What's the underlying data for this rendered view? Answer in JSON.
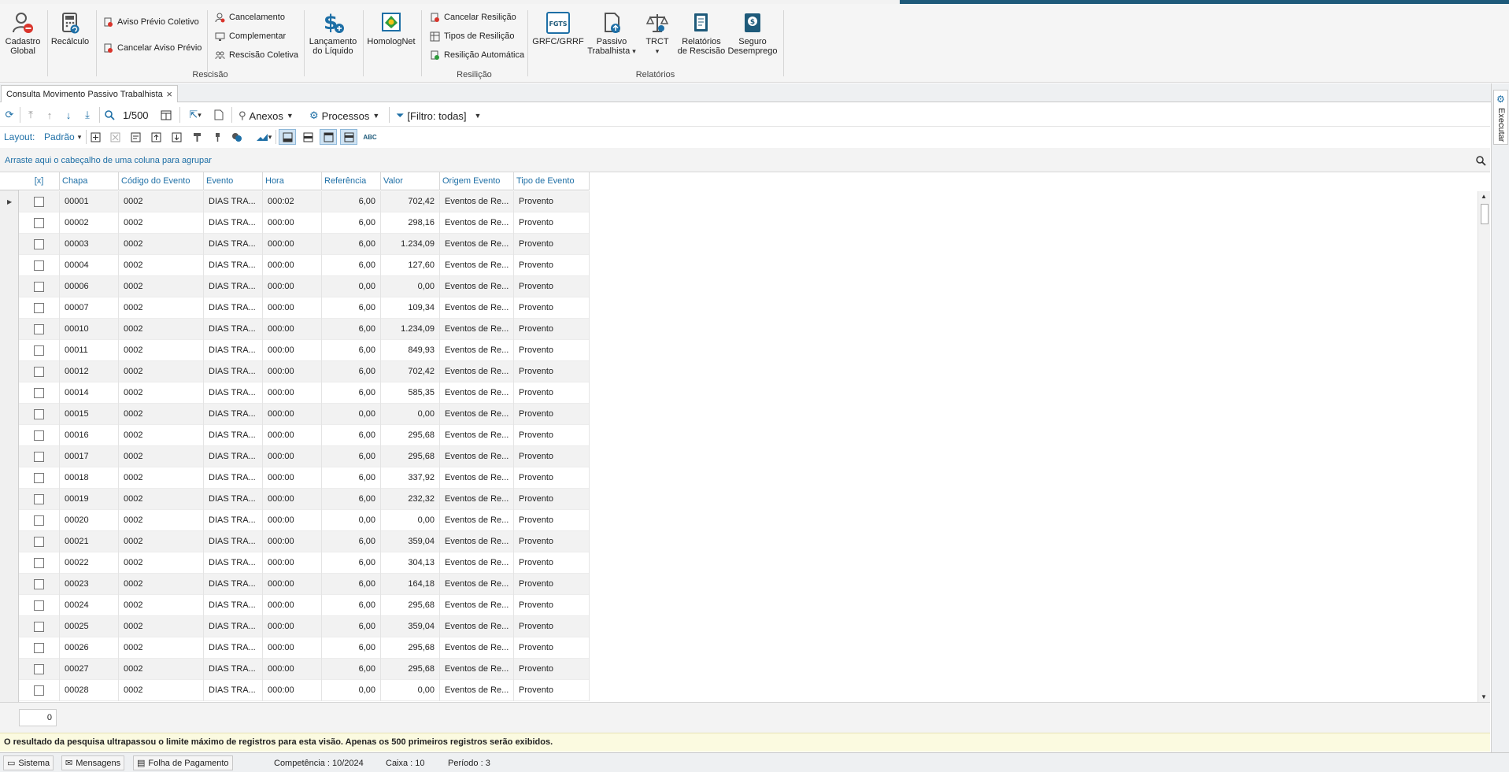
{
  "ribbon": {
    "cadastro_global": [
      "Cadastro",
      "Global"
    ],
    "recalculo": "Recálculo",
    "aviso_previo_coletivo": "Aviso Prévio Coletivo",
    "cancelar_aviso_previo": "Cancelar Aviso Prévio",
    "cancelamento": "Cancelamento",
    "complementar": "Complementar",
    "rescisao_coletiva": "Rescisão Coletiva",
    "lancamento_liquido": [
      "Lançamento",
      "do Líquido"
    ],
    "homolognet": "HomologNet",
    "cancelar_resiliacao": "Cancelar Resilição",
    "tipos_resiliacao": "Tipos de Resilição",
    "resiliacao_automatica": "Resilição Automática",
    "grfc_grrf": "GRFC/GRRF",
    "passivo_trabalhista": [
      "Passivo",
      "Trabalhista"
    ],
    "trct": "TRCT",
    "relatorios_rescisao": [
      "Relatórios",
      "de Rescisão"
    ],
    "seguro_desemprego": [
      "Seguro",
      "Desemprego"
    ],
    "fgts_icon_text": "FGTS",
    "group_rescisao": "Rescisão",
    "group_resiliacao": "Resilição",
    "group_relatorios": "Relatórios"
  },
  "tab": {
    "title": "Consulta Movimento Passivo Trabalhista"
  },
  "toolbar": {
    "record_counter": "1/500",
    "anexos": "Anexos",
    "processos": "Processos",
    "filtro": "[Filtro: todas]",
    "layout_label": "Layout:",
    "layout_value": "Padrão"
  },
  "group_hint": "Arraste aqui o cabeçalho de uma coluna para agrupar",
  "grid": {
    "columns": [
      "[x]",
      "Chapa",
      "Código do Evento",
      "Evento",
      "Hora",
      "Referência",
      "Valor",
      "Origem Evento",
      "Tipo de Evento"
    ],
    "rows": [
      {
        "chapa": "00001",
        "codigo": "0002",
        "evento": "DIAS TRA...",
        "hora": "000:02",
        "referencia": "6,00",
        "valor": "702,42",
        "origem": "Eventos de Re...",
        "tipo": "Provento"
      },
      {
        "chapa": "00002",
        "codigo": "0002",
        "evento": "DIAS TRA...",
        "hora": "000:00",
        "referencia": "6,00",
        "valor": "298,16",
        "origem": "Eventos de Re...",
        "tipo": "Provento"
      },
      {
        "chapa": "00003",
        "codigo": "0002",
        "evento": "DIAS TRA...",
        "hora": "000:00",
        "referencia": "6,00",
        "valor": "1.234,09",
        "origem": "Eventos de Re...",
        "tipo": "Provento"
      },
      {
        "chapa": "00004",
        "codigo": "0002",
        "evento": "DIAS TRA...",
        "hora": "000:00",
        "referencia": "6,00",
        "valor": "127,60",
        "origem": "Eventos de Re...",
        "tipo": "Provento"
      },
      {
        "chapa": "00006",
        "codigo": "0002",
        "evento": "DIAS TRA...",
        "hora": "000:00",
        "referencia": "0,00",
        "valor": "0,00",
        "origem": "Eventos de Re...",
        "tipo": "Provento"
      },
      {
        "chapa": "00007",
        "codigo": "0002",
        "evento": "DIAS TRA...",
        "hora": "000:00",
        "referencia": "6,00",
        "valor": "109,34",
        "origem": "Eventos de Re...",
        "tipo": "Provento"
      },
      {
        "chapa": "00010",
        "codigo": "0002",
        "evento": "DIAS TRA...",
        "hora": "000:00",
        "referencia": "6,00",
        "valor": "1.234,09",
        "origem": "Eventos de Re...",
        "tipo": "Provento"
      },
      {
        "chapa": "00011",
        "codigo": "0002",
        "evento": "DIAS TRA...",
        "hora": "000:00",
        "referencia": "6,00",
        "valor": "849,93",
        "origem": "Eventos de Re...",
        "tipo": "Provento"
      },
      {
        "chapa": "00012",
        "codigo": "0002",
        "evento": "DIAS TRA...",
        "hora": "000:00",
        "referencia": "6,00",
        "valor": "702,42",
        "origem": "Eventos de Re...",
        "tipo": "Provento"
      },
      {
        "chapa": "00014",
        "codigo": "0002",
        "evento": "DIAS TRA...",
        "hora": "000:00",
        "referencia": "6,00",
        "valor": "585,35",
        "origem": "Eventos de Re...",
        "tipo": "Provento"
      },
      {
        "chapa": "00015",
        "codigo": "0002",
        "evento": "DIAS TRA...",
        "hora": "000:00",
        "referencia": "0,00",
        "valor": "0,00",
        "origem": "Eventos de Re...",
        "tipo": "Provento"
      },
      {
        "chapa": "00016",
        "codigo": "0002",
        "evento": "DIAS TRA...",
        "hora": "000:00",
        "referencia": "6,00",
        "valor": "295,68",
        "origem": "Eventos de Re...",
        "tipo": "Provento"
      },
      {
        "chapa": "00017",
        "codigo": "0002",
        "evento": "DIAS TRA...",
        "hora": "000:00",
        "referencia": "6,00",
        "valor": "295,68",
        "origem": "Eventos de Re...",
        "tipo": "Provento"
      },
      {
        "chapa": "00018",
        "codigo": "0002",
        "evento": "DIAS TRA...",
        "hora": "000:00",
        "referencia": "6,00",
        "valor": "337,92",
        "origem": "Eventos de Re...",
        "tipo": "Provento"
      },
      {
        "chapa": "00019",
        "codigo": "0002",
        "evento": "DIAS TRA...",
        "hora": "000:00",
        "referencia": "6,00",
        "valor": "232,32",
        "origem": "Eventos de Re...",
        "tipo": "Provento"
      },
      {
        "chapa": "00020",
        "codigo": "0002",
        "evento": "DIAS TRA...",
        "hora": "000:00",
        "referencia": "0,00",
        "valor": "0,00",
        "origem": "Eventos de Re...",
        "tipo": "Provento"
      },
      {
        "chapa": "00021",
        "codigo": "0002",
        "evento": "DIAS TRA...",
        "hora": "000:00",
        "referencia": "6,00",
        "valor": "359,04",
        "origem": "Eventos de Re...",
        "tipo": "Provento"
      },
      {
        "chapa": "00022",
        "codigo": "0002",
        "evento": "DIAS TRA...",
        "hora": "000:00",
        "referencia": "6,00",
        "valor": "304,13",
        "origem": "Eventos de Re...",
        "tipo": "Provento"
      },
      {
        "chapa": "00023",
        "codigo": "0002",
        "evento": "DIAS TRA...",
        "hora": "000:00",
        "referencia": "6,00",
        "valor": "164,18",
        "origem": "Eventos de Re...",
        "tipo": "Provento"
      },
      {
        "chapa": "00024",
        "codigo": "0002",
        "evento": "DIAS TRA...",
        "hora": "000:00",
        "referencia": "6,00",
        "valor": "295,68",
        "origem": "Eventos de Re...",
        "tipo": "Provento"
      },
      {
        "chapa": "00025",
        "codigo": "0002",
        "evento": "DIAS TRA...",
        "hora": "000:00",
        "referencia": "6,00",
        "valor": "359,04",
        "origem": "Eventos de Re...",
        "tipo": "Provento"
      },
      {
        "chapa": "00026",
        "codigo": "0002",
        "evento": "DIAS TRA...",
        "hora": "000:00",
        "referencia": "6,00",
        "valor": "295,68",
        "origem": "Eventos de Re...",
        "tipo": "Provento"
      },
      {
        "chapa": "00027",
        "codigo": "0002",
        "evento": "DIAS TRA...",
        "hora": "000:00",
        "referencia": "6,00",
        "valor": "295,68",
        "origem": "Eventos de Re...",
        "tipo": "Provento"
      },
      {
        "chapa": "00028",
        "codigo": "0002",
        "evento": "DIAS TRA...",
        "hora": "000:00",
        "referencia": "0,00",
        "valor": "0,00",
        "origem": "Eventos de Re...",
        "tipo": "Provento"
      }
    ]
  },
  "footer": {
    "selected_count": "0"
  },
  "warning": "O resultado da pesquisa ultrapassou o limite máximo de registros para esta visão. Apenas os 500 primeiros registros serão exibidos.",
  "statusbar": {
    "sistema": "Sistema",
    "mensagens": "Mensagens",
    "folha": "Folha de Pagamento",
    "competencia": "Competência : 10/2024",
    "caixa": "Caixa : 10",
    "periodo": "Período : 3"
  },
  "side_panel": {
    "executar": "Executar"
  },
  "colors": {
    "accent": "#1e6fa6",
    "topbar": "#1e5a7a",
    "warning_bg": "#fbfae0"
  }
}
